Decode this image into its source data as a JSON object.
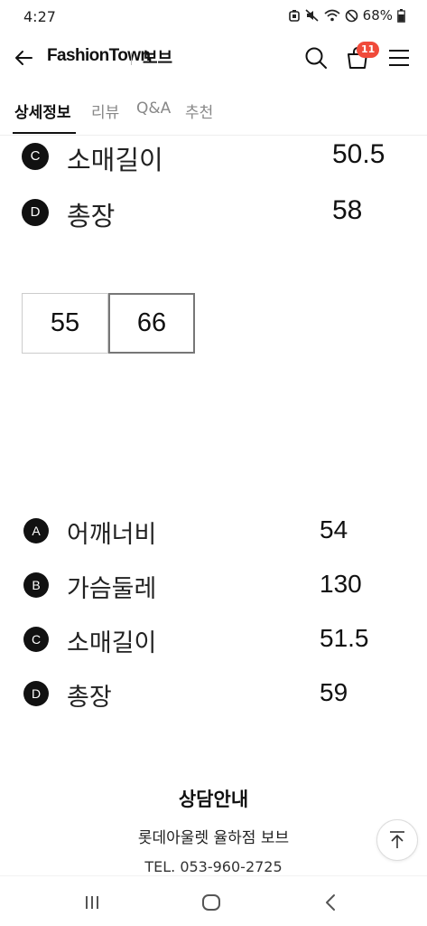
{
  "status": {
    "time": "4:27",
    "battery": "68%"
  },
  "header": {
    "brand": "FashionTown",
    "store": "보브",
    "cart_count": "11"
  },
  "tabs": [
    {
      "label": "상세정보",
      "active": true
    },
    {
      "label": "리뷰",
      "active": false
    },
    {
      "label": "Q&A",
      "active": false
    },
    {
      "label": "추천",
      "active": false
    }
  ],
  "size55_rows": [
    {
      "letter": "C",
      "label": "소매길이",
      "value": "50.5"
    },
    {
      "letter": "D",
      "label": "총장",
      "value": "58"
    }
  ],
  "size_tabs": [
    {
      "label": "55",
      "selected": false
    },
    {
      "label": "66",
      "selected": true
    }
  ],
  "size66_rows": [
    {
      "letter": "A",
      "label": "어깨너비",
      "value": "54"
    },
    {
      "letter": "B",
      "label": "가슴둘레",
      "value": "130"
    },
    {
      "letter": "C",
      "label": "소매길이",
      "value": "51.5"
    },
    {
      "letter": "D",
      "label": "총장",
      "value": "59"
    }
  ],
  "consult": {
    "title": "상담안내",
    "store": "롯데아울렛 율하점 보브",
    "tel": "TEL. 053-960-2725"
  },
  "icons": {
    "back": "arrow-left-icon",
    "search": "search-icon",
    "cart": "shopping-bag-icon",
    "menu": "hamburger-menu-icon",
    "top": "scroll-to-top-icon"
  },
  "colors": {
    "badge": "#f04a3a",
    "text": "#111111"
  }
}
